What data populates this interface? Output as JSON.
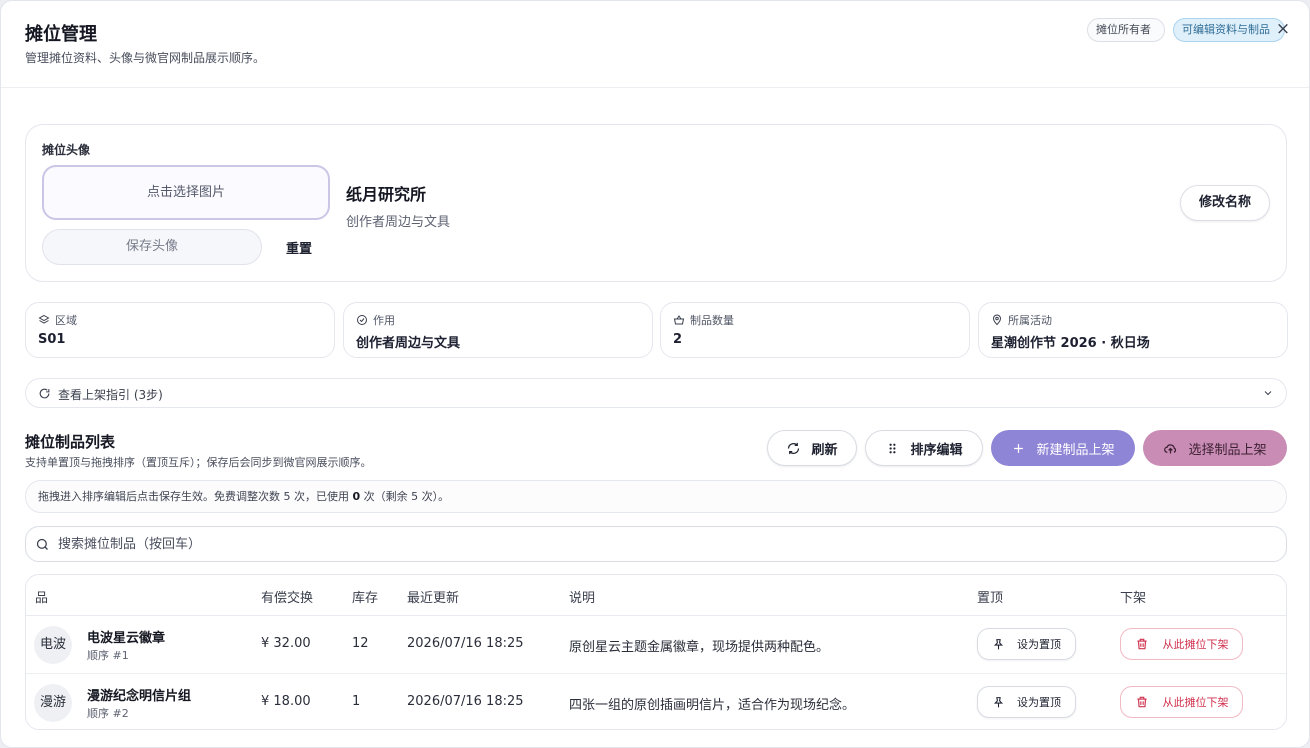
{
  "header": {
    "title": "摊位管理",
    "subtitle": "管理摊位资料、头像与微官网制品展示顺序。",
    "badge_owner": "摊位所有者",
    "badge_edit": "可编辑资料与制品",
    "close_icon": "×"
  },
  "avatar": {
    "label": "摊位头像",
    "pick_label": "点击选择图片",
    "save_label": "保存头像",
    "reset_label": "重置",
    "booth_name": "纸月研究所",
    "booth_desc": "创作者周边与文具",
    "rename_label": "修改名称"
  },
  "info": [
    {
      "icon": "layers-icon",
      "label": "区域",
      "value": "S01"
    },
    {
      "icon": "check-circle-icon",
      "label": "作用",
      "value": "创作者周边与文具"
    },
    {
      "icon": "basket-icon",
      "label": "制品数量",
      "value": "2"
    },
    {
      "icon": "location-pin-icon",
      "label": "所属活动",
      "value": "星潮创作节 2026 · 秋日场"
    }
  ],
  "guide": {
    "label": "查看上架指引 (3步)"
  },
  "list": {
    "title": "摊位制品列表",
    "subtitle": "支持单置顶与拖拽排序（置顶互斥）；保存后会同步到微官网展示顺序。",
    "refresh_label": "刷新",
    "sort_label": "排序编辑",
    "new_label": "新建制品上架",
    "pick_label": "选择制品上架",
    "notice_prefix": "拖拽进入排序编辑后点击保存生效。免费调整次数 5 次，已使用 ",
    "notice_used": "0",
    "notice_suffix": " 次（剩余 5 次）。",
    "search_placeholder": "搜索摊位制品（按回车）",
    "search_value": ""
  },
  "table": {
    "columns": [
      "品",
      "有偿交换",
      "库存",
      "最近更新",
      "说明",
      "置顶",
      "下架"
    ],
    "rows": [
      {
        "thumb": "电波",
        "name": "电波星云徽章",
        "order": "顺序 #1",
        "price": "¥ 32.00",
        "stock": "12",
        "updated": "2026/07/16 18:25",
        "desc": "原创星云主题金属徽章，现场提供两种配色。",
        "pin_label": "设为置顶",
        "remove_label": "从此摊位下架"
      },
      {
        "thumb": "漫游",
        "name": "漫游纪念明信片组",
        "order": "顺序 #2",
        "price": "¥ 18.00",
        "stock": "1",
        "updated": "2026/07/16 18:25",
        "desc": "四张一组的原创插画明信片，适合作为现场纪念。",
        "pin_label": "设为置顶",
        "remove_label": "从此摊位下架"
      }
    ]
  },
  "colors": {
    "accent_purple": "#8f85d6",
    "accent_pink": "#c98db5",
    "danger": "#d0324f",
    "badge_blue": "#dff0fb"
  }
}
